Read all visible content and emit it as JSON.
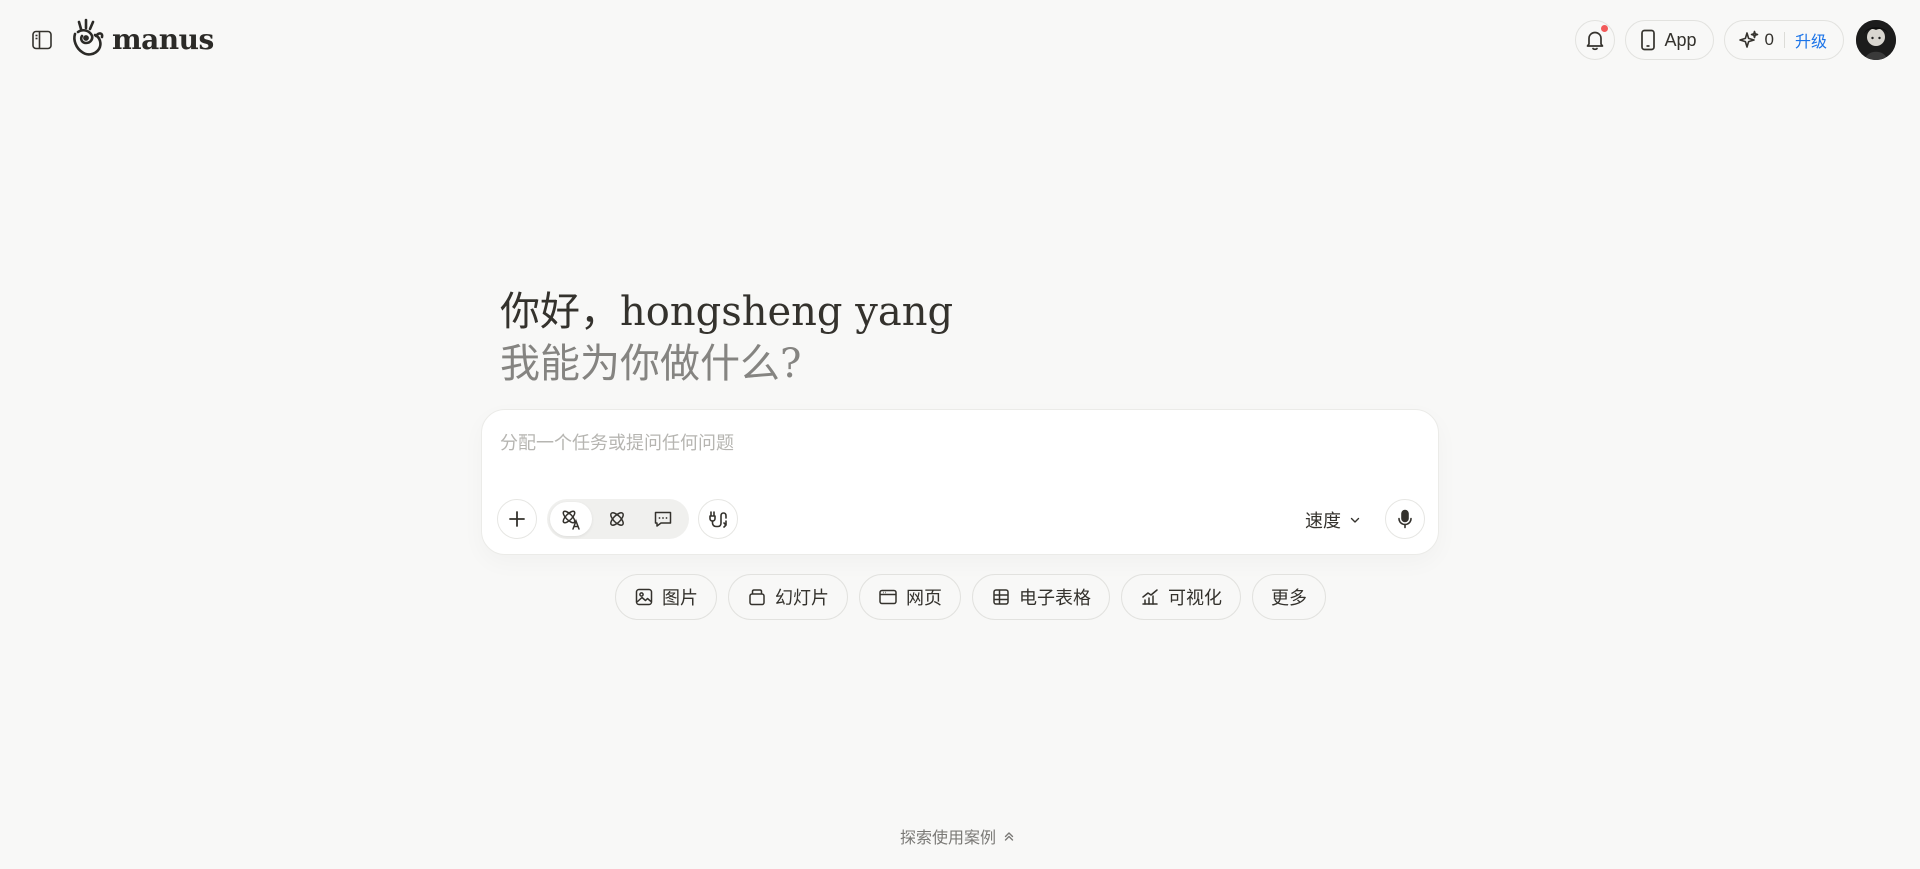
{
  "app": {
    "name": "manus"
  },
  "header": {
    "app_button_label": "App",
    "credits": "0",
    "upgrade_label": "升级",
    "notification_dot_color": "#f25a5a"
  },
  "greeting": {
    "line1": "你好，hongsheng yang",
    "line2": "我能为你做什么?"
  },
  "composer": {
    "placeholder": "分配一个任务或提问任何问题",
    "value": "",
    "speed_label": "速度"
  },
  "quick_actions": [
    {
      "label": "图片",
      "icon": "image-icon"
    },
    {
      "label": "幻灯片",
      "icon": "slides-icon"
    },
    {
      "label": "网页",
      "icon": "webpage-icon"
    },
    {
      "label": "电子表格",
      "icon": "spreadsheet-icon"
    },
    {
      "label": "可视化",
      "icon": "chart-icon"
    },
    {
      "label": "更多",
      "icon": ""
    }
  ],
  "footer": {
    "explore_label": "探索使用案例"
  },
  "colors": {
    "accent": "#1a73e8",
    "background": "#f8f8f7",
    "text": "#34322d",
    "muted": "#858481"
  }
}
